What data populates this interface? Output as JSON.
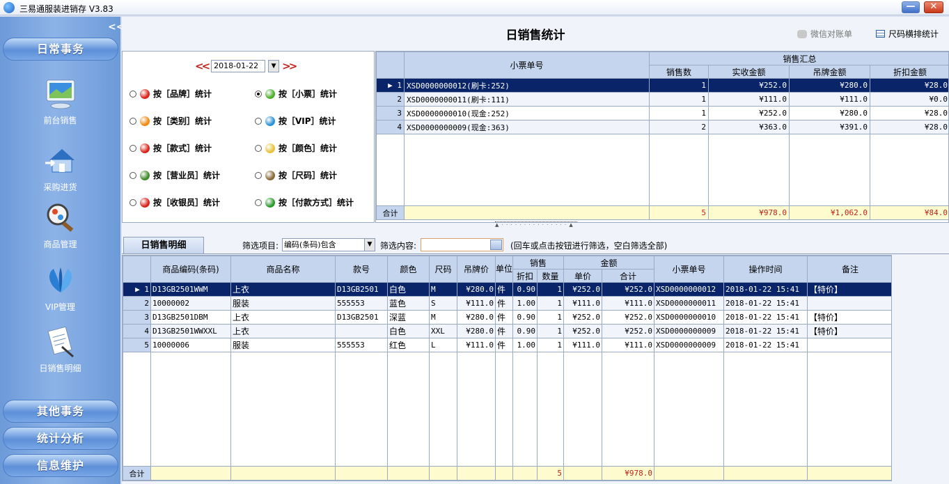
{
  "app": {
    "title": "三易通服装进销存 V3.83"
  },
  "sidebar": {
    "collapse": "<<",
    "top_button": "日常事务",
    "items": [
      {
        "label": "前台销售",
        "icon": "monitor-icon"
      },
      {
        "label": "采购进货",
        "icon": "house-icon"
      },
      {
        "label": "商品管理",
        "icon": "magnifier-icon"
      },
      {
        "label": "VIP管理",
        "icon": "vip-icon"
      },
      {
        "label": "日销售明细",
        "icon": "document-icon"
      }
    ],
    "bottom_buttons": [
      "其他事务",
      "统计分析",
      "信息维护"
    ]
  },
  "header": {
    "title": "日销售统计",
    "wechat": "微信对账单",
    "size_stats": "尺码横排统计"
  },
  "date": {
    "prev": "<<",
    "value": "2018-01-22",
    "next": ">>"
  },
  "options": [
    {
      "label": "按［品牌］统计",
      "selected": false,
      "color": "#d8241b"
    },
    {
      "label": "按［小票］统计",
      "selected": true,
      "color": "#4caf2e"
    },
    {
      "label": "按［类别］统计",
      "selected": false,
      "color": "#f08a12"
    },
    {
      "label": "按［VIP］统计",
      "selected": false,
      "color": "#2a93d6"
    },
    {
      "label": "按［款式］统计",
      "selected": false,
      "color": "#d8241b"
    },
    {
      "label": "按［颜色］统计",
      "selected": false,
      "color": "#e8c23a"
    },
    {
      "label": "按［营业员］统计",
      "selected": false,
      "color": "#3f8a2a"
    },
    {
      "label": "按［尺码］统计",
      "selected": false,
      "color": "#8a6a3a"
    },
    {
      "label": "按［收银员］统计",
      "selected": false,
      "color": "#d8241b"
    },
    {
      "label": "按［付款方式］统计",
      "selected": false,
      "color": "#2e9a2e"
    }
  ],
  "summary": {
    "group_header": "销售汇总",
    "columns": [
      "小票单号",
      "销售数",
      "实收金额",
      "吊牌金额",
      "折扣金额"
    ],
    "rows": [
      {
        "no": "1",
        "ticket": "XSD0000000012(刷卡:252)",
        "qty": "1",
        "paid": "¥252.0",
        "tag": "¥280.0",
        "disc": "¥28.0"
      },
      {
        "no": "2",
        "ticket": "XSD0000000011(刷卡:111)",
        "qty": "1",
        "paid": "¥111.0",
        "tag": "¥111.0",
        "disc": "¥0.0"
      },
      {
        "no": "3",
        "ticket": "XSD0000000010(现金:252)",
        "qty": "1",
        "paid": "¥252.0",
        "tag": "¥280.0",
        "disc": "¥28.0"
      },
      {
        "no": "4",
        "ticket": "XSD0000000009(现金:363)",
        "qty": "2",
        "paid": "¥363.0",
        "tag": "¥391.0",
        "disc": "¥28.0"
      }
    ],
    "total": {
      "label": "合计",
      "qty": "5",
      "paid": "¥978.0",
      "tag": "¥1,062.0",
      "disc": "¥84.0"
    }
  },
  "detail": {
    "tab": "日销售明细",
    "filter_label": "筛选项目:",
    "filter_value": "编码(条码)包含",
    "content_label": "筛选内容:",
    "hint": "(回车或点击按钮进行筛选，空白筛选全部)",
    "group_sales": "销售",
    "group_amount": "金额",
    "columns": [
      "商品编码(条码)",
      "商品名称",
      "款号",
      "颜色",
      "尺码",
      "吊牌价",
      "单位",
      "折扣",
      "数量",
      "单价",
      "合计",
      "小票单号",
      "操作时间",
      "备注"
    ],
    "rows": [
      {
        "no": "1",
        "code": "D13GB2501WWM",
        "name": "上衣",
        "style": "D13GB2501",
        "color": "白色",
        "size": "M",
        "price": "¥280.0",
        "unit": "件",
        "disc": "0.90",
        "qty": "1",
        "unit_price": "¥252.0",
        "sum": "¥252.0",
        "ticket": "XSD0000000012",
        "time": "2018-01-22 15:41",
        "note": "【特价】"
      },
      {
        "no": "2",
        "code": "10000002",
        "name": "服装",
        "style": "555553",
        "color": "蓝色",
        "size": "S",
        "price": "¥111.0",
        "unit": "件",
        "disc": "1.00",
        "qty": "1",
        "unit_price": "¥111.0",
        "sum": "¥111.0",
        "ticket": "XSD0000000011",
        "time": "2018-01-22 15:41",
        "note": ""
      },
      {
        "no": "3",
        "code": "D13GB2501DBM",
        "name": "上衣",
        "style": "D13GB2501",
        "color": "深蓝",
        "size": "M",
        "price": "¥280.0",
        "unit": "件",
        "disc": "0.90",
        "qty": "1",
        "unit_price": "¥252.0",
        "sum": "¥252.0",
        "ticket": "XSD0000000010",
        "time": "2018-01-22 15:41",
        "note": "【特价】"
      },
      {
        "no": "4",
        "code": "D13GB2501WWXXL",
        "name": "上衣",
        "style": "",
        "color": "白色",
        "size": "XXL",
        "price": "¥280.0",
        "unit": "件",
        "disc": "0.90",
        "qty": "1",
        "unit_price": "¥252.0",
        "sum": "¥252.0",
        "ticket": "XSD0000000009",
        "time": "2018-01-22 15:41",
        "note": "【特价】"
      },
      {
        "no": "5",
        "code": "10000006",
        "name": "服装",
        "style": "555553",
        "color": "红色",
        "size": "L",
        "price": "¥111.0",
        "unit": "件",
        "disc": "1.00",
        "qty": "1",
        "unit_price": "¥111.0",
        "sum": "¥111.0",
        "ticket": "XSD0000000009",
        "time": "2018-01-22 15:41",
        "note": ""
      }
    ],
    "total": {
      "label": "合计",
      "qty": "5",
      "sum": "¥978.0"
    }
  }
}
